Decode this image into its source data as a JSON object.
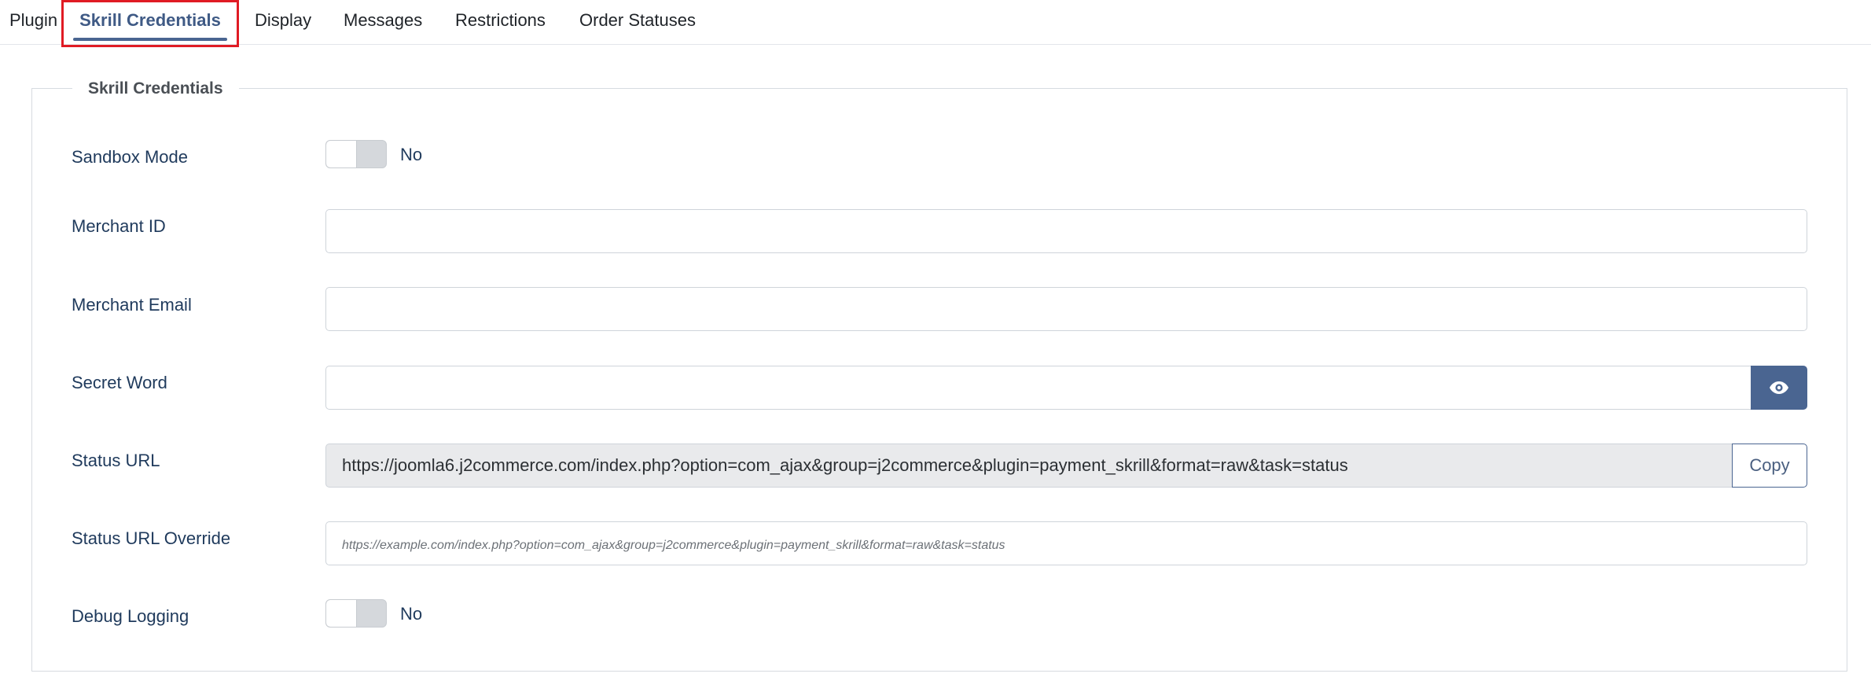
{
  "tabs": [
    {
      "label": "Plugin"
    },
    {
      "label": "Skrill Credentials"
    },
    {
      "label": "Display"
    },
    {
      "label": "Messages"
    },
    {
      "label": "Restrictions"
    },
    {
      "label": "Order Statuses"
    }
  ],
  "active_tab": "Skrill Credentials",
  "fieldset": {
    "legend": "Skrill Credentials",
    "sandbox_mode": {
      "label": "Sandbox Mode",
      "state": "No"
    },
    "merchant_id": {
      "label": "Merchant ID",
      "value": ""
    },
    "merchant_email": {
      "label": "Merchant Email",
      "value": ""
    },
    "secret_word": {
      "label": "Secret Word",
      "value": "",
      "toggle_icon": "eye-icon"
    },
    "status_url": {
      "label": "Status URL",
      "value": "https://joomla6.j2commerce.com/index.php?option=com_ajax&group=j2commerce&plugin=payment_skrill&format=raw&task=status",
      "copy_label": "Copy"
    },
    "status_url_override": {
      "label": "Status URL Override",
      "value": "",
      "placeholder": "https://example.com/index.php?option=com_ajax&group=j2commerce&plugin=payment_skrill&format=raw&task=status"
    },
    "debug_logging": {
      "label": "Debug Logging",
      "state": "No"
    }
  },
  "colors": {
    "accent": "#4a6591",
    "highlight_box": "#e01b24",
    "label_text": "#1f3a5c"
  }
}
